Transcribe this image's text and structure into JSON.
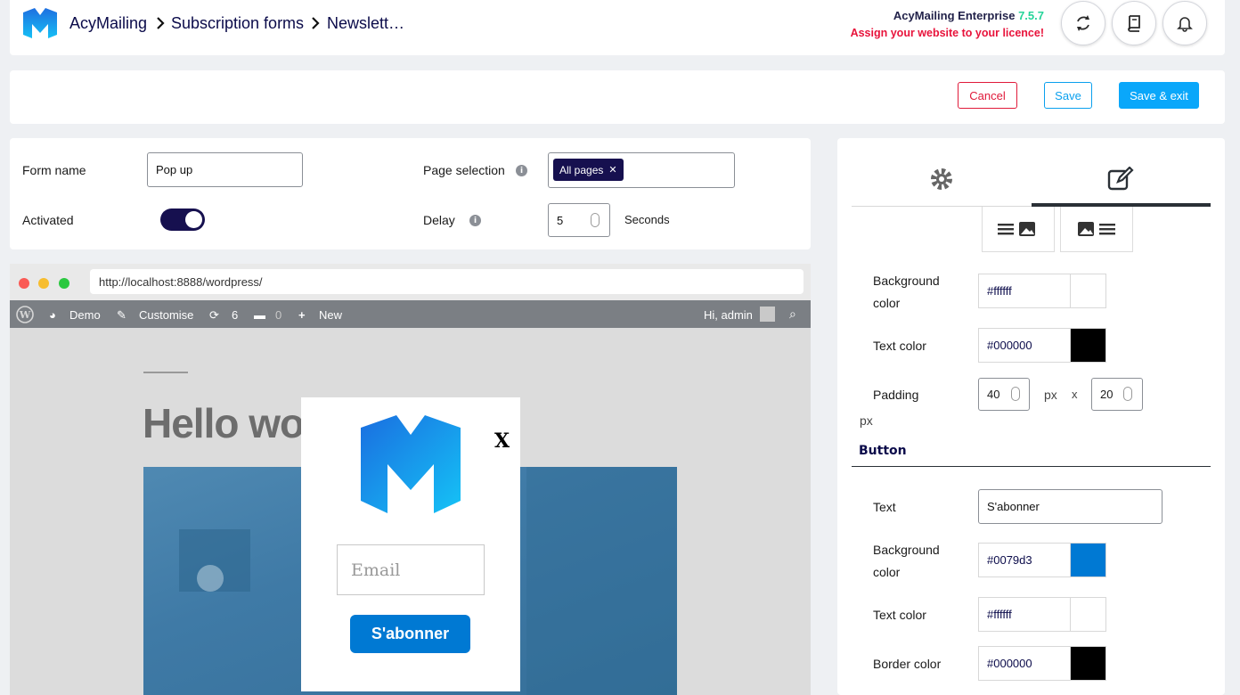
{
  "header": {
    "breadcrumb": [
      "AcyMailing",
      "Subscription forms",
      "Newslett…"
    ],
    "license_product": "AcyMailing Enterprise",
    "license_version": "7.5.7",
    "license_warning": "Assign your website to your licence!",
    "icons": [
      "refresh-icon",
      "book-icon",
      "bell-icon"
    ]
  },
  "actions": {
    "cancel": "Cancel",
    "save": "Save",
    "save_exit": "Save & exit"
  },
  "form": {
    "name_label": "Form name",
    "name_value": "Pop up",
    "activated_label": "Activated",
    "activated": true,
    "page_label": "Page selection",
    "page_tag": "All pages",
    "delay_label": "Delay",
    "delay_value": "5",
    "delay_unit": "Seconds"
  },
  "preview": {
    "url": "http://localhost:8888/wordpress/",
    "wp_bar": {
      "site": "Demo",
      "customise": "Customise",
      "updates": "6",
      "comments": "0",
      "new": "New",
      "greeting": "Hi, admin"
    },
    "post_title": "Hello wo",
    "popup": {
      "close": "X",
      "email_placeholder": "Email",
      "button": "S'abonner"
    }
  },
  "panel": {
    "bg_color_label": "Background color",
    "bg_color_value": "#ffffff",
    "text_color_label": "Text color",
    "text_color_value": "#000000",
    "padding_label": "Padding",
    "padding_v": "40",
    "padding_h": "20",
    "px": "px",
    "x": "x",
    "button_section": "Button",
    "btn_text_label": "Text",
    "btn_text_value": "S'abonner",
    "btn_bg_label": "Background color",
    "btn_bg_value": "#0079d3",
    "btn_text_color_label": "Text color",
    "btn_text_color_value": "#ffffff",
    "btn_border_label": "Border color",
    "btn_border_value": "#000000"
  },
  "colors": {
    "navy": "#16104f",
    "accent": "#0aa7fa",
    "danger": "#e01a3a",
    "license_version": "#26d49a"
  }
}
